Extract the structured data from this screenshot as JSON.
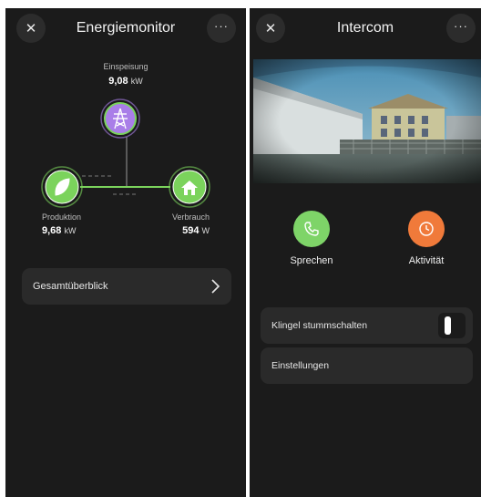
{
  "energy": {
    "title": "Energiemonitor",
    "close_icon": "close-icon",
    "more_icon": "more-dots-icon",
    "feed_in": {
      "label": "Einspeisung",
      "value": "9,08",
      "unit": "kW",
      "icon": "power-pylon-icon",
      "color": "#a97ee8"
    },
    "production": {
      "label": "Produktion",
      "value": "9,68",
      "unit": "kW",
      "icon": "leaf-icon",
      "color": "#7bd35c"
    },
    "consumption": {
      "label": "Verbrauch",
      "value": "594",
      "unit": "W",
      "icon": "house-icon",
      "color": "#7bd35c"
    },
    "overview_label": "Gesamtüberblick",
    "accent_green": "#7bd35c"
  },
  "intercom": {
    "title": "Intercom",
    "close_icon": "close-icon",
    "more_icon": "more-dots-icon",
    "speak_label": "Sprechen",
    "speak_color": "#7ed468",
    "activity_label": "Aktivität",
    "activity_color": "#f07a3a",
    "mute_label": "Klingel stummschalten",
    "mute_on": true,
    "settings_label": "Einstellungen"
  }
}
